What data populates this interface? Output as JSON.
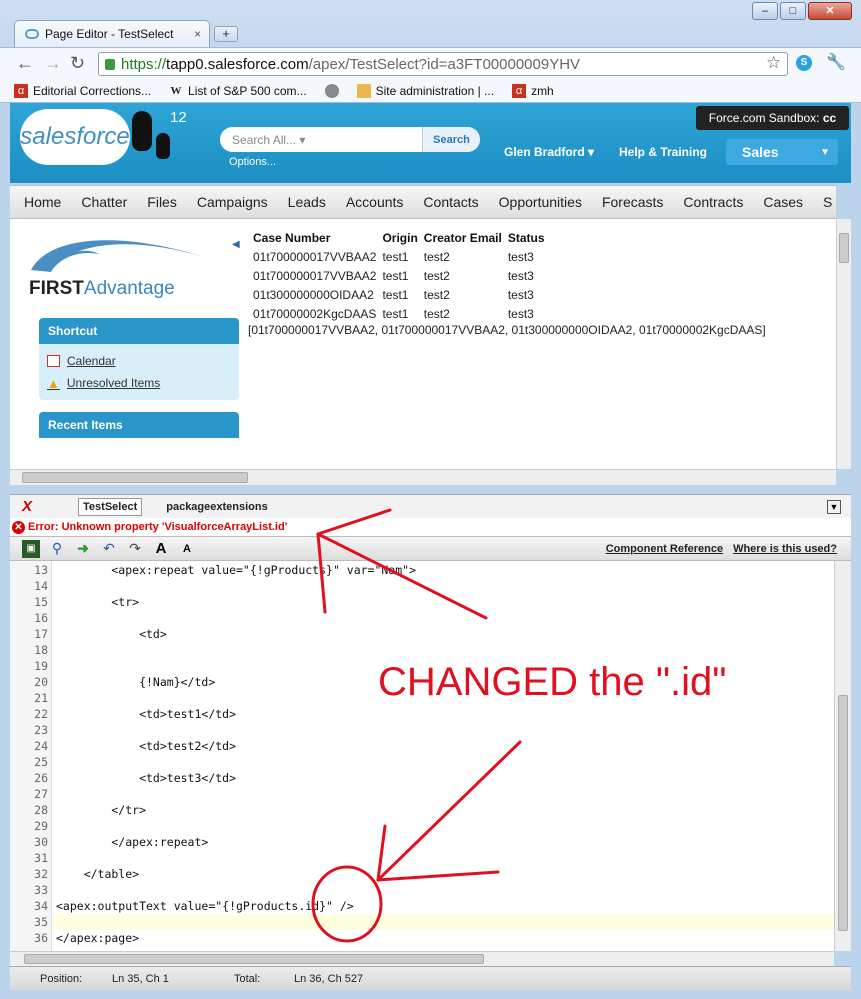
{
  "browser": {
    "tab_title": "Page Editor - TestSelect",
    "tab_close": "×",
    "new_tab": "+",
    "url_scheme": "https://",
    "url_host": "tapp0.salesforce.com",
    "url_path": "/apex/TestSelect?id=a3FT00000009YHV",
    "window_buttons": [
      "–",
      "□",
      "✕"
    ],
    "bookmarks": [
      {
        "label": "Editorial Corrections...",
        "icon": "alpha-icon"
      },
      {
        "label": "List of S&P 500 com...",
        "icon": "wikipedia-icon"
      },
      {
        "label": "",
        "icon": "globe-icon"
      },
      {
        "label": "Site administration | ...",
        "icon": "site-icon"
      },
      {
        "label": "zmh",
        "icon": "alpha-icon"
      }
    ]
  },
  "sf_header": {
    "logo_text": "salesforce",
    "logo_badge": "12",
    "search_placeholder": "Search All...",
    "search_button": "Search",
    "options_link": "Options...",
    "user_name": "Glen Bradford",
    "help_link": "Help & Training",
    "sandbox_label": "Force.com Sandbox:",
    "sandbox_value": "cc",
    "app_menu": "Sales"
  },
  "nav_tabs": [
    "Home",
    "Chatter",
    "Files",
    "Campaigns",
    "Leads",
    "Accounts",
    "Contacts",
    "Opportunities",
    "Forecasts",
    "Contracts",
    "Cases",
    "S"
  ],
  "sidebar": {
    "brand_first": "FIRST",
    "brand_second": "Advantage",
    "shortcut_title": "Shortcut",
    "shortcut_items": [
      "Calendar",
      "Unresolved Items"
    ],
    "recent_title": "Recent Items"
  },
  "case_table": {
    "headers": [
      "Case Number",
      "Origin",
      "Creator Email",
      "Status"
    ],
    "rows": [
      [
        "01t700000017VVBAA2",
        "test1",
        "test2",
        "test3"
      ],
      [
        "01t700000017VVBAA2",
        "test1",
        "test2",
        "test3"
      ],
      [
        "01t300000000OIDAA2",
        "test1",
        "test2",
        "test3"
      ],
      [
        "01t70000002KgcDAAS",
        "test1",
        "test2",
        "test3"
      ]
    ],
    "array_output": "[01t700000017VVBAA2, 01t700000017VVBAA2, 01t300000000OIDAA2, 01t70000002KgcDAAS]"
  },
  "editor": {
    "tabs": [
      "TestSelect",
      "packageextensions"
    ],
    "error": "Error: Unknown property 'VisualforceArrayList.id'",
    "links": [
      "Component Reference",
      "Where is this used?"
    ],
    "lines": [
      {
        "n": "13",
        "code": "        <apex:repeat value=\"{!gProducts}\" var=\"Nam\">"
      },
      {
        "n": "14",
        "code": ""
      },
      {
        "n": "15",
        "code": "        <tr>"
      },
      {
        "n": "16",
        "code": ""
      },
      {
        "n": "17",
        "code": "            <td>"
      },
      {
        "n": "18",
        "code": ""
      },
      {
        "n": "19",
        "code": ""
      },
      {
        "n": "20",
        "code": "            {!Nam}</td>"
      },
      {
        "n": "21",
        "code": ""
      },
      {
        "n": "22",
        "code": "            <td>test1</td>"
      },
      {
        "n": "23",
        "code": ""
      },
      {
        "n": "24",
        "code": "            <td>test2</td>"
      },
      {
        "n": "25",
        "code": ""
      },
      {
        "n": "26",
        "code": "            <td>test3</td>"
      },
      {
        "n": "27",
        "code": ""
      },
      {
        "n": "28",
        "code": "        </tr>"
      },
      {
        "n": "29",
        "code": ""
      },
      {
        "n": "30",
        "code": "        </apex:repeat>"
      },
      {
        "n": "31",
        "code": ""
      },
      {
        "n": "32",
        "code": "    </table>"
      },
      {
        "n": "33",
        "code": ""
      },
      {
        "n": "34",
        "code": "<apex:outputText value=\"{!gProducts.id}\" />"
      },
      {
        "n": "35",
        "code": ""
      },
      {
        "n": "36",
        "code": "</apex:page>"
      }
    ],
    "status": {
      "position_label": "Position:",
      "position_value": "Ln 35, Ch 1",
      "total_label": "Total:",
      "total_value": "Ln 36, Ch 527"
    }
  },
  "annotation": {
    "text": "CHANGED the \".id\"",
    "color": "#e01020"
  }
}
